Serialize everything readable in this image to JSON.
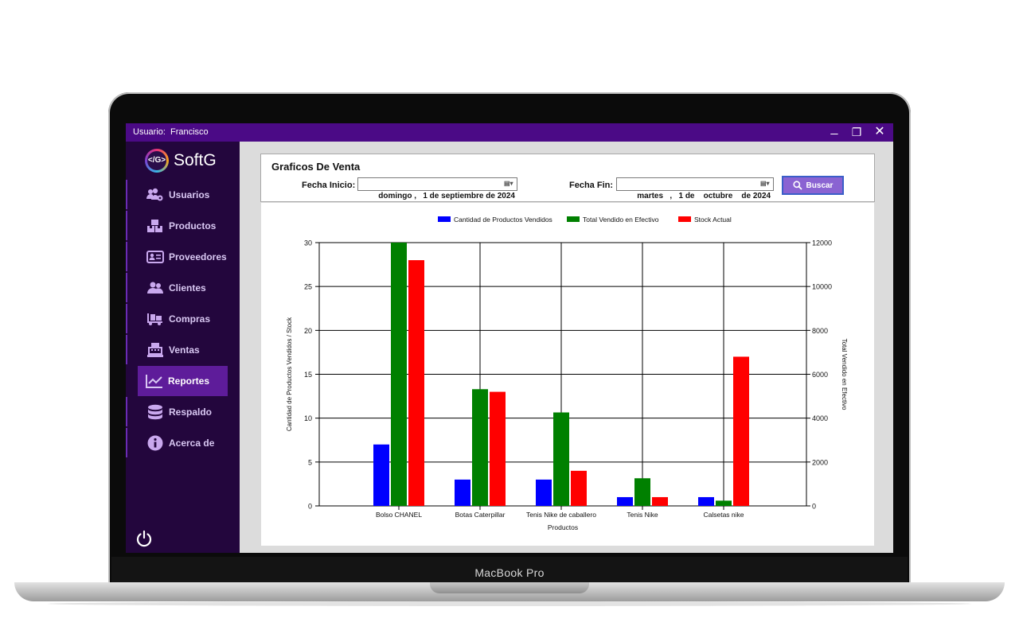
{
  "device": {
    "model_label": "MacBook Pro"
  },
  "window": {
    "user_label": "Usuario:",
    "user_name": "Francisco",
    "minimize_glyph": "_",
    "restore_glyph": "❐",
    "close_glyph": "✕"
  },
  "sidebar": {
    "logo_mark": "</G>",
    "logo_text": "SoftG",
    "items": [
      {
        "label": "Usuarios",
        "icon": "users-gear-icon"
      },
      {
        "label": "Productos",
        "icon": "boxes-icon"
      },
      {
        "label": "Proveedores",
        "icon": "address-card-icon"
      },
      {
        "label": "Clientes",
        "icon": "users-icon"
      },
      {
        "label": "Compras",
        "icon": "dolly-icon"
      },
      {
        "label": "Ventas",
        "icon": "cash-register-icon"
      },
      {
        "label": "Reportes",
        "icon": "chart-line-icon",
        "active": true
      },
      {
        "label": "Respaldo",
        "icon": "database-icon"
      },
      {
        "label": "Acerca de",
        "icon": "info-circle-icon"
      }
    ],
    "power_icon": "power-icon"
  },
  "filter": {
    "title": "Graficos De Venta",
    "start_label": "Fecha Inicio:",
    "start_value": "domingo ,   1 de septiembre de 2024",
    "end_label": "Fecha Fin:",
    "end_value": "martes   ,   1 de    octubre    de 2024",
    "search_label": "Buscar"
  },
  "colors": {
    "titlebar": "#4b0a86",
    "sidebar": "#23063d",
    "active_item": "#5e1c9a",
    "series_qty": "#0000ff",
    "series_cash": "#008000",
    "series_stock": "#ff0000"
  },
  "chart_data": {
    "type": "bar",
    "xlabel": "Productos",
    "ylabel": "Cantidad de Productos Vendidos / Stock",
    "y2label": "Total Vendido en Efectivo",
    "categories": [
      "Bolso CHANEL",
      "Botas Caterpillar",
      "Tenis Nike de caballero",
      "Tenis Nike",
      "Calsetas nike"
    ],
    "ylim": [
      0,
      30
    ],
    "yticks": [
      0,
      5,
      10,
      15,
      20,
      25,
      30
    ],
    "y2lim": [
      0,
      12000
    ],
    "y2ticks": [
      0,
      2000,
      4000,
      6000,
      8000,
      10000,
      12000
    ],
    "legend_position": "top-center",
    "grid": true,
    "series": [
      {
        "name": "Cantidad de Productos Vendidos",
        "axis": "left",
        "color": "#0000ff",
        "values": [
          7,
          3,
          3,
          1,
          1
        ]
      },
      {
        "name": "Total Vendido en Efectivo",
        "axis": "right",
        "color": "#008000",
        "values": [
          12000,
          5320,
          4260,
          1260,
          240
        ]
      },
      {
        "name": "Stock Actual",
        "axis": "left",
        "color": "#ff0000",
        "values": [
          28,
          13,
          4,
          1,
          17
        ]
      }
    ]
  }
}
